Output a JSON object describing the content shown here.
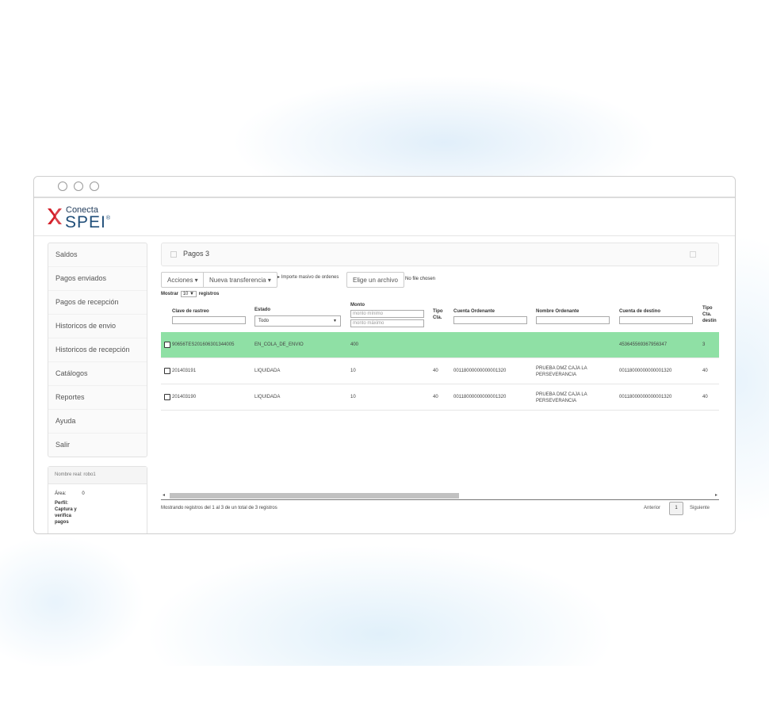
{
  "brand": {
    "top": "Conecta",
    "main": "SPEI",
    "mark": "®"
  },
  "sidebar": {
    "items": [
      {
        "label": "Saldos"
      },
      {
        "label": "Pagos enviados"
      },
      {
        "label": "Pagos de recepción"
      },
      {
        "label": "Historicos de envio"
      },
      {
        "label": "Historicos de recepción"
      },
      {
        "label": "Catálogos"
      },
      {
        "label": "Reportes"
      },
      {
        "label": "Ayuda"
      },
      {
        "label": "Salir"
      }
    ],
    "user": {
      "name_line": "Nombre real: robo1",
      "area_label": "Área:",
      "area_value": "0",
      "perfil": "Perfil: Captura y verifica pagos"
    }
  },
  "panel": {
    "title": "Pagos 3"
  },
  "toolbar": {
    "acciones": "Acciones ▾",
    "nueva": "Nueva transferencia ▾",
    "importe": "▸ Importe masivo de ordenes",
    "elige": "Elige un archivo",
    "nofile": "No file chosen"
  },
  "length": {
    "prefix": "Mostrar",
    "value": "10 ▼",
    "suffix": "registros"
  },
  "columns": {
    "clave": "Clave de rastreo",
    "estado": "Estado",
    "estado_select": "Todo",
    "monto": "Monto",
    "monto_min": "monto mínimo",
    "monto_max": "monto máximo",
    "tipo": "Tipo Cta.",
    "cuenta_ord": "Cuenta Ordenante",
    "nombre_ord": "Nombre Ordenante",
    "cuenta_dest": "Cuenta de destino",
    "tipo_dest": "Tipo Cta. destin"
  },
  "rows": [
    {
      "clave": "90656TES20160630134400​5",
      "estado": "EN_COLA_DE_ENVIO",
      "monto": "400",
      "tipo": "",
      "cuenta_ord": "",
      "nombre_ord": "",
      "cuenta_dest": "453645569367956347",
      "tipo_dest": "3",
      "highlight": true
    },
    {
      "clave": "201403191",
      "estado": "LIQUIDADA",
      "monto": "10",
      "tipo": "40",
      "cuenta_ord": "00118000000000001320",
      "nombre_ord": "PRUEBA DMZ CAJA LA PERSEVERANCIA",
      "cuenta_dest": "00118000000000001320",
      "tipo_dest": "40"
    },
    {
      "clave": "201403190",
      "estado": "LIQUIDADA",
      "monto": "10",
      "tipo": "40",
      "cuenta_ord": "00118000000000001320",
      "nombre_ord": "PRUEBA DMZ CAJA LA PERSEVERANCIA",
      "cuenta_dest": "00118000000000001320",
      "tipo_dest": "40"
    }
  ],
  "footer": {
    "info": "Mostrando registros del 1 al 3 de un total de 3 registros",
    "anterior": "Anterior",
    "page": "1",
    "siguiente": "Siguiente"
  },
  "scroll": {
    "left": "◂",
    "right": "▸"
  },
  "colors": {
    "highlight_row": "#8fe0a5",
    "brand_red": "#d4202a",
    "brand_blue": "#1f4e79"
  }
}
